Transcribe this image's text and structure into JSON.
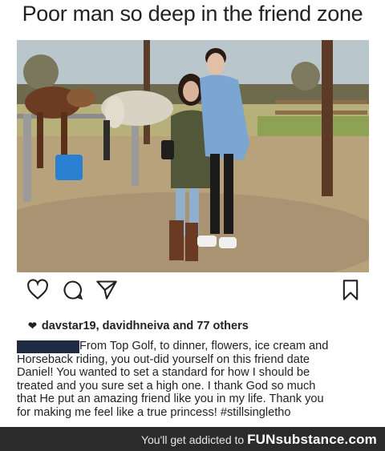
{
  "meme": {
    "title": "Poor man so deep in the friend zone"
  },
  "post": {
    "icons": {
      "like": "heart-outline-icon",
      "comment": "comment-bubble-icon",
      "share": "paper-plane-icon",
      "save": "bookmark-icon"
    },
    "likes_text": "davstar19, davidhneiva and 77 others",
    "caption_lines": [
      "From Top Golf, to dinner, flowers, ice cream and",
      "Horseback riding, you out-did yourself on this friend date",
      "Daniel! You wanted to set a standard for how I should be",
      "treated and you sure set a high one. I thank God so much",
      "that He put an amazing friend like you in my life. Thank you",
      "for making me feel like a true princess! #stillsinglethо"
    ]
  },
  "footer": {
    "tagline": "You'll get addicted to",
    "brand": "FUNsubstance.com"
  },
  "colors": {
    "footer_bg": "#2b2b2b",
    "redaction": "#1f2a44",
    "text": "#222222"
  }
}
